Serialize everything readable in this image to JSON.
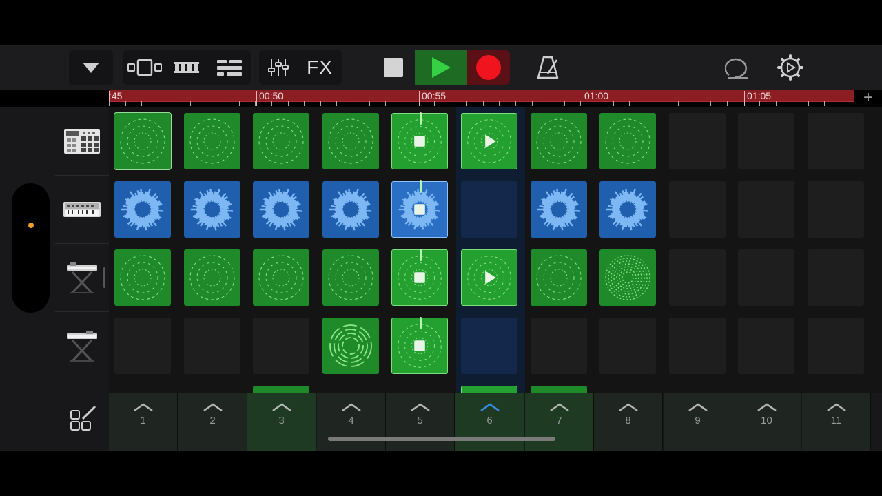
{
  "toolbar": {
    "fx_label": "FX",
    "buttons": [
      "browser-toggle",
      "live-loops-view",
      "tracks-view",
      "list-view",
      "mixer",
      "fx",
      "stop",
      "play",
      "record",
      "metronome",
      "loop-browser",
      "settings"
    ],
    "colors": {
      "play_bg": "#1e6b24",
      "play_icon": "#36d045",
      "record_bg": "#5a1014",
      "record_icon": "#f0141e"
    }
  },
  "ruler": {
    "labels": [
      ":45",
      "00:50",
      "00:55",
      "01:00",
      "01:05"
    ],
    "add_label": "+"
  },
  "tracks": [
    {
      "name": "drum-machine",
      "icon": "drum-machine-icon"
    },
    {
      "name": "synth",
      "icon": "synth-icon"
    },
    {
      "name": "keyboard",
      "icon": "keyboard-stand-icon"
    },
    {
      "name": "keyboard-2",
      "icon": "keyboard-stand-icon"
    }
  ],
  "grid": {
    "columns": 11,
    "rows": [
      [
        "green-outlined",
        "green",
        "green",
        "green",
        "green-playing",
        "green-queued",
        "green",
        "green",
        "empty",
        "empty",
        "empty"
      ],
      [
        "blue",
        "blue",
        "blue",
        "blue",
        "blue-playing",
        "empty-hl",
        "blue",
        "blue",
        "empty",
        "empty",
        "empty"
      ],
      [
        "green",
        "green",
        "green",
        "green",
        "green-playing",
        "green-queued",
        "green",
        "green",
        "empty",
        "empty",
        "empty"
      ],
      [
        "empty",
        "empty",
        "empty",
        "green",
        "green-playing",
        "empty-hl",
        "empty",
        "empty",
        "empty",
        "empty",
        "empty"
      ]
    ],
    "highlighted_column": 6
  },
  "triggers": {
    "labels": [
      "1",
      "2",
      "3",
      "4",
      "5",
      "6",
      "7",
      "8",
      "9",
      "10",
      "11"
    ],
    "active_column": 6
  }
}
